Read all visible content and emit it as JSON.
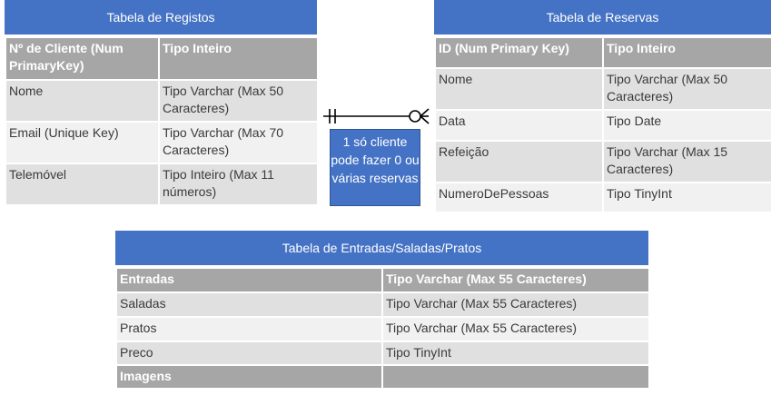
{
  "registos": {
    "title": "Tabela de Registos",
    "rows": [
      [
        "Nº de Cliente (Num PrimaryKey)",
        "Tipo Inteiro"
      ],
      [
        "Nome",
        "Tipo Varchar (Max  50 Caracteres)"
      ],
      [
        "Email (Unique Key)",
        "Tipo Varchar (Max 70 Caracteres)"
      ],
      [
        "Telemóvel",
        "Tipo Inteiro (Max  11 números)"
      ]
    ]
  },
  "reservas": {
    "title": "Tabela de Reservas",
    "rows": [
      [
        "ID (Num Primary Key)",
        "Tipo Inteiro"
      ],
      [
        "Nome",
        "Tipo Varchar (Max 50 Caracteres)"
      ],
      [
        "Data",
        "Tipo Date"
      ],
      [
        "Refeição",
        "Tipo Varchar (Max 15 Caracteres)"
      ],
      [
        "NumeroDePessoas",
        "Tipo TinyInt"
      ]
    ]
  },
  "relationship": {
    "note": "1 só cliente pode fazer 0 ou várias reservas",
    "type": "one-to-zero-or-many"
  },
  "entradas": {
    "title": "Tabela de Entradas/Saladas/Pratos",
    "rows": [
      [
        "Entradas",
        "Tipo Varchar (Max 55 Caracteres)"
      ],
      [
        "Saladas",
        "Tipo Varchar (Max 55 Caracteres)"
      ],
      [
        "Pratos",
        "Tipo Varchar (Max 55 Caracteres)"
      ],
      [
        "Preco",
        "Tipo TinyInt"
      ],
      [
        "Imagens",
        ""
      ]
    ]
  }
}
